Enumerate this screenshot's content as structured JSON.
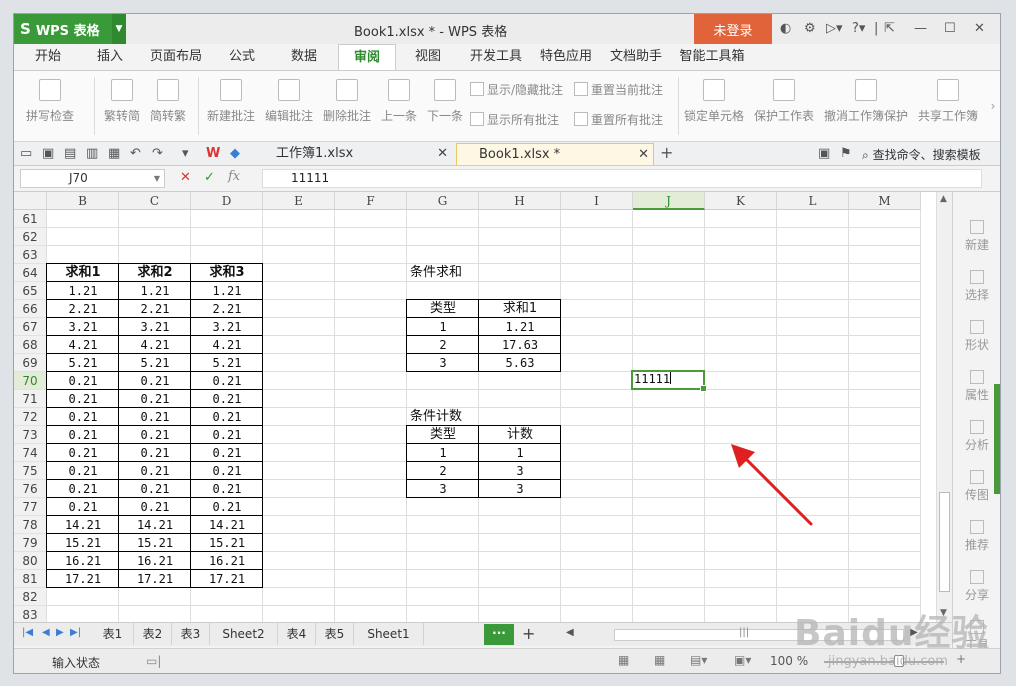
{
  "window": {
    "app_menu_label": "WPS 表格",
    "title": "Book1.xlsx * - WPS 表格",
    "login_label": "未登录"
  },
  "menu_tabs": [
    "开始",
    "插入",
    "页面布局",
    "公式",
    "数据",
    "审阅",
    "视图",
    "开发工具",
    "特色应用",
    "文档助手",
    "智能工具箱"
  ],
  "active_menu_tab": "审阅",
  "ribbon": {
    "spell_check": "拼写检查",
    "to_traditional": "繁转简",
    "to_simplified": "简转繁",
    "new_comment": "新建批注",
    "edit_comment": "编辑批注",
    "delete_comment": "删除批注",
    "prev": "上一条",
    "next": "下一条",
    "show_hide_comments": "显示/隐藏批注",
    "show_all_comments": "显示所有批注",
    "reset_current_comment": "重置当前批注",
    "reset_all_comments": "重置所有批注",
    "lock_cell": "锁定单元格",
    "protect_sheet": "保护工作表",
    "unprotect_workbook": "撤消工作簿保护",
    "share_workbook": "共享工作簿"
  },
  "file_tabs": [
    {
      "label": "工作簿1.xlsx",
      "active": false
    },
    {
      "label": "Book1.xlsx *",
      "active": true
    }
  ],
  "search_commands": "查找命令、搜索模板",
  "formula_bar": {
    "name_box": "J70",
    "value": "11111"
  },
  "columns": [
    "B",
    "C",
    "D",
    "E",
    "F",
    "G",
    "H",
    "I",
    "J",
    "K",
    "L",
    "M"
  ],
  "selected_column": "J",
  "rows": [
    "61",
    "62",
    "63",
    "64",
    "65",
    "66",
    "67",
    "68",
    "69",
    "70",
    "71",
    "72",
    "73",
    "74",
    "75",
    "76",
    "77",
    "78",
    "79",
    "80",
    "81",
    "82",
    "83"
  ],
  "selected_row": "70",
  "table_main": {
    "headers": [
      "求和1",
      "求和2",
      "求和3"
    ],
    "values": [
      "1.21",
      "2.21",
      "3.21",
      "4.21",
      "5.21",
      "0.21",
      "0.21",
      "0.21",
      "0.21",
      "0.21",
      "0.21",
      "0.21",
      "0.21",
      "14.21",
      "15.21",
      "16.21",
      "17.21"
    ]
  },
  "sum_section": {
    "title": "条件求和",
    "headers": [
      "类型",
      "求和1"
    ],
    "rows": [
      [
        "1",
        "1.21"
      ],
      [
        "2",
        "17.63"
      ],
      [
        "3",
        "5.63"
      ]
    ]
  },
  "count_section": {
    "title": "条件计数",
    "headers": [
      "类型",
      "计数"
    ],
    "rows": [
      [
        "1",
        "1"
      ],
      [
        "2",
        "3"
      ],
      [
        "3",
        "3"
      ]
    ]
  },
  "active_cell_value": "11111",
  "side_panel": [
    "新建",
    "选择",
    "形状",
    "属性",
    "分析",
    "传图",
    "推荐",
    "分享",
    "工具"
  ],
  "sheet_tabs": [
    "表1",
    "表2",
    "表3",
    "Sheet2",
    "表4",
    "表5",
    "Sheet1"
  ],
  "status": {
    "mode": "输入状态",
    "zoom": "100 %"
  },
  "watermark": {
    "logo": "Baidu经验",
    "url": "jingyan.baidu.com"
  },
  "colors": {
    "accent_green": "#3a9a3a",
    "login_orange": "#e0633a",
    "arrow_red": "#e02020"
  }
}
